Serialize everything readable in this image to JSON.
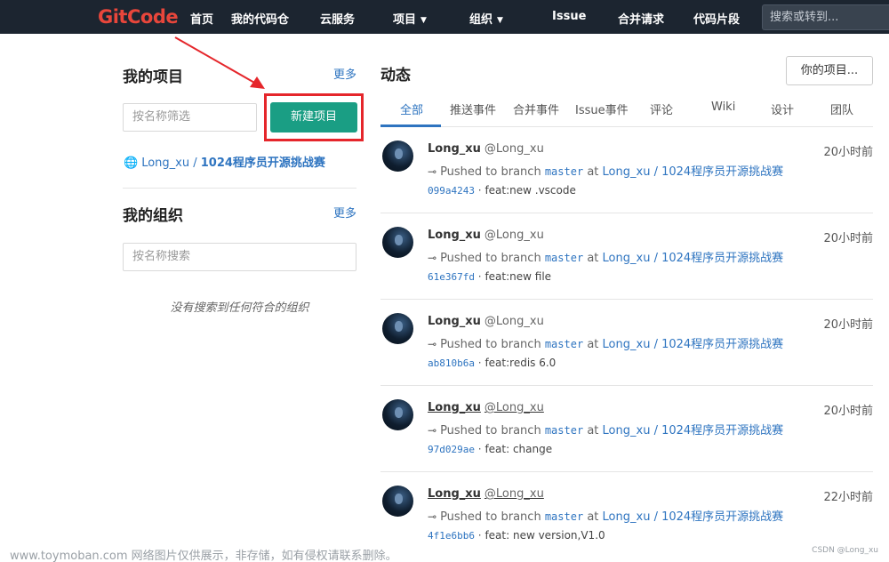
{
  "topbar": {
    "logo": {
      "git": "Git",
      "code": "Code"
    },
    "nav": [
      {
        "label": "首页"
      },
      {
        "label": "我的代码仓"
      },
      {
        "label": "云服务"
      },
      {
        "label": "项目",
        "caret": "▼"
      },
      {
        "label": "组织",
        "caret": "▼"
      },
      {
        "label": "Issue"
      },
      {
        "label": "合并请求"
      },
      {
        "label": "代码片段"
      }
    ],
    "search_placeholder": "搜索或转到..."
  },
  "left": {
    "projects_title": "我的项目",
    "projects_more": "更多",
    "project_filter_placeholder": "按名称筛选",
    "new_project_label": "新建项目",
    "project_owner": "Long_xu",
    "project_separator": " / ",
    "project_name": "1024程序员开源挑战赛",
    "orgs_title": "我的组织",
    "orgs_more": "更多",
    "org_search_placeholder": "按名称搜索",
    "orgs_empty": "没有搜索到任何符合的组织"
  },
  "feed": {
    "title": "动态",
    "your_projects": "你的项目...",
    "tabs": [
      "全部",
      "推送事件",
      "合并事件",
      "Issue事件",
      "评论",
      "Wiki",
      "设计",
      "团队"
    ],
    "active_tab": "全部",
    "events": [
      {
        "user": "Long_xu",
        "handle": "@Long_xu",
        "time": "20小时前",
        "action": "Pushed to branch",
        "branch": "master",
        "at": "at",
        "repo": "Long_xu / 1024程序员开源挑战赛",
        "sha": "099a4243",
        "message": "feat:new .vscode"
      },
      {
        "user": "Long_xu",
        "handle": "@Long_xu",
        "time": "20小时前",
        "action": "Pushed to branch",
        "branch": "master",
        "at": "at",
        "repo": "Long_xu / 1024程序员开源挑战赛",
        "sha": "61e367fd",
        "message": "feat:new file"
      },
      {
        "user": "Long_xu",
        "handle": "@Long_xu",
        "time": "20小时前",
        "action": "Pushed to branch",
        "branch": "master",
        "at": "at",
        "repo": "Long_xu / 1024程序员开源挑战赛",
        "sha": "ab810b6a",
        "message": "feat:redis 6.0"
      },
      {
        "user": "Long_xu",
        "handle": "@Long_xu",
        "time": "20小时前",
        "action": "Pushed to branch",
        "branch": "master",
        "at": "at",
        "repo": "Long_xu / 1024程序员开源挑战赛",
        "sha": "97d029ae",
        "message": "feat: change"
      },
      {
        "user": "Long_xu",
        "handle": "@Long_xu",
        "time": "22小时前",
        "action": "Pushed to branch",
        "branch": "master",
        "at": "at",
        "repo": "Long_xu / 1024程序员开源挑战赛",
        "sha": "4f1e6bb6",
        "message": "feat: new version,V1.0"
      }
    ]
  },
  "watermark": "www.toymoban.com 网络图片仅供展示，非存储，如有侵权请联系删除。",
  "csdn_mark": "CSDN @Long_xu",
  "colors": {
    "topbar": "#1c2530",
    "logo": "#e8463b",
    "accent_green": "#1a9e84",
    "link_blue": "#2e74c0",
    "highlight_red": "#e5262b"
  }
}
